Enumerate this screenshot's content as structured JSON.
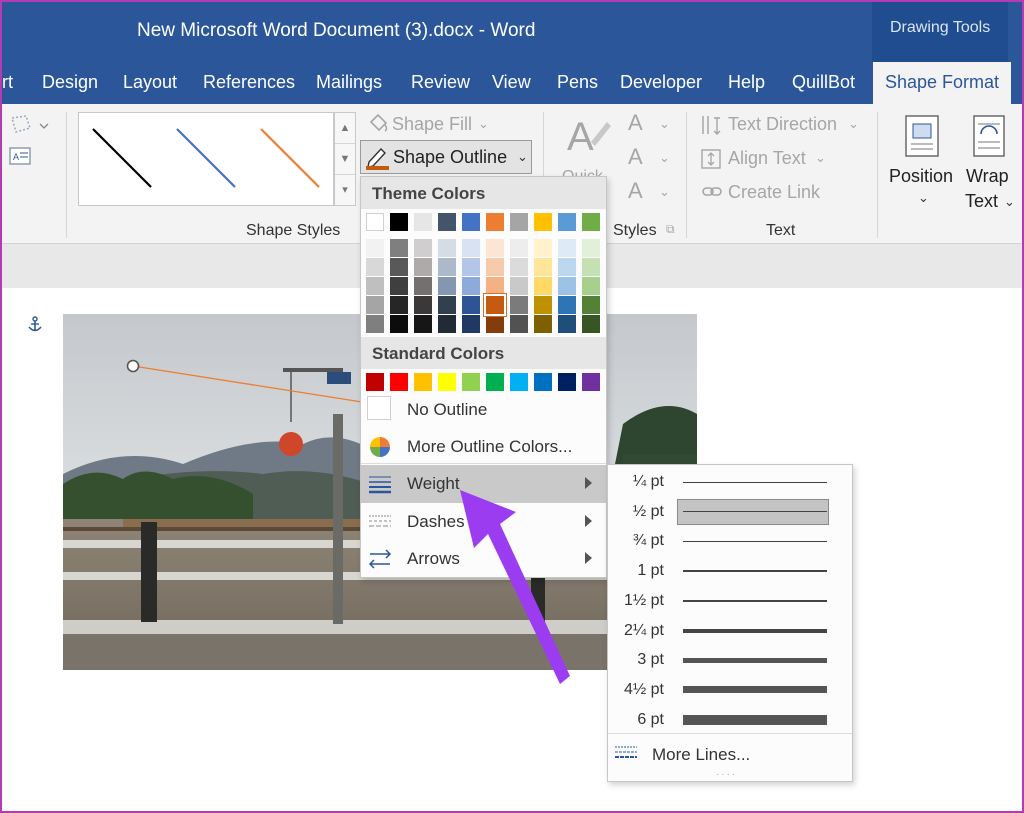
{
  "title_bar": {
    "document_title": "New Microsoft Word Document (3).docx  -  Word",
    "context_tab_group": "Drawing Tools"
  },
  "tabs": [
    {
      "label": "rt",
      "active": false
    },
    {
      "label": "Design",
      "active": false
    },
    {
      "label": "Layout",
      "active": false
    },
    {
      "label": "References",
      "active": false
    },
    {
      "label": "Mailings",
      "active": false
    },
    {
      "label": "Review",
      "active": false
    },
    {
      "label": "View",
      "active": false
    },
    {
      "label": "Pens",
      "active": false
    },
    {
      "label": "Developer",
      "active": false
    },
    {
      "label": "Help",
      "active": false
    },
    {
      "label": "QuillBot",
      "active": false
    },
    {
      "label": "Shape Format",
      "active": true
    }
  ],
  "ribbon": {
    "shape_fill": "Shape Fill",
    "shape_outline": "Shape Outline",
    "shape_styles_label": "Shape Styles",
    "wordart_styles_label": "Styles",
    "quick_styles_fragment": "Quick",
    "text_direction": "Text Direction",
    "align_text": "Align Text",
    "create_link": "Create Link",
    "text_group_label": "Text",
    "position": "Position",
    "wrap_text_line1": "Wrap",
    "wrap_text_line2": "Text",
    "gallery_line_colors": [
      "#000000",
      "#4472c4",
      "#ed7d31"
    ],
    "outline_current_color": "#c55a11"
  },
  "outline_menu": {
    "theme_colors_header": "Theme Colors",
    "theme_colors_top": [
      "#ffffff",
      "#000000",
      "#e7e6e6",
      "#44546a",
      "#4472c4",
      "#ed7d31",
      "#a5a5a5",
      "#ffc000",
      "#5b9bd5",
      "#70ad47"
    ],
    "theme_colors_shades": [
      [
        "#f2f2f2",
        "#7f7f7f",
        "#d0cece",
        "#d6dce4",
        "#d9e2f3",
        "#fbe5d5",
        "#ededed",
        "#fff2cc",
        "#deebf6",
        "#e2efd9"
      ],
      [
        "#d8d8d8",
        "#595959",
        "#aeaaaa",
        "#adb9ca",
        "#b4c6e7",
        "#f7caac",
        "#dbdbdb",
        "#fee599",
        "#bdd7ee",
        "#c5e0b3"
      ],
      [
        "#bfbfbf",
        "#3f3f3f",
        "#757070",
        "#8496b0",
        "#8eaadb",
        "#f4b183",
        "#c9c9c9",
        "#ffd965",
        "#9cc3e5",
        "#a8d08d"
      ],
      [
        "#a5a5a5",
        "#262626",
        "#3a3838",
        "#323f4f",
        "#2f5496",
        "#c55a11",
        "#7b7b7b",
        "#bf9000",
        "#2e75b5",
        "#538135"
      ],
      [
        "#7f7f7f",
        "#0c0c0c",
        "#171616",
        "#222a35",
        "#1f3864",
        "#833c0b",
        "#525252",
        "#7f6000",
        "#1e4e79",
        "#375623"
      ]
    ],
    "standard_colors_header": "Standard Colors",
    "standard_colors": [
      "#c00000",
      "#ff0000",
      "#ffc000",
      "#ffff00",
      "#92d050",
      "#00b050",
      "#00b0f0",
      "#0070c0",
      "#002060",
      "#7030a0"
    ],
    "no_outline": "No Outline",
    "more_outline_colors": "More Outline Colors...",
    "weight": "Weight",
    "dashes": "Dashes",
    "arrows": "Arrows"
  },
  "weight_submenu": {
    "options": [
      {
        "label": "¼ pt",
        "pt": 0.25,
        "selected": false
      },
      {
        "label": "½ pt",
        "pt": 0.5,
        "selected": true
      },
      {
        "label": "¾ pt",
        "pt": 0.75,
        "selected": false
      },
      {
        "label": "1 pt",
        "pt": 1,
        "selected": false
      },
      {
        "label": "1½ pt",
        "pt": 1.5,
        "selected": false
      },
      {
        "label": "2¼ pt",
        "pt": 2.25,
        "selected": false
      },
      {
        "label": "3 pt",
        "pt": 3,
        "selected": false
      },
      {
        "label": "4½ pt",
        "pt": 4.5,
        "selected": false
      },
      {
        "label": "6 pt",
        "pt": 6,
        "selected": false
      }
    ],
    "more_lines": "More Lines..."
  },
  "colors": {
    "word_blue": "#2b579a",
    "annotation_arrow": "#9b3cf0",
    "selected_line": "#ed7d31"
  }
}
